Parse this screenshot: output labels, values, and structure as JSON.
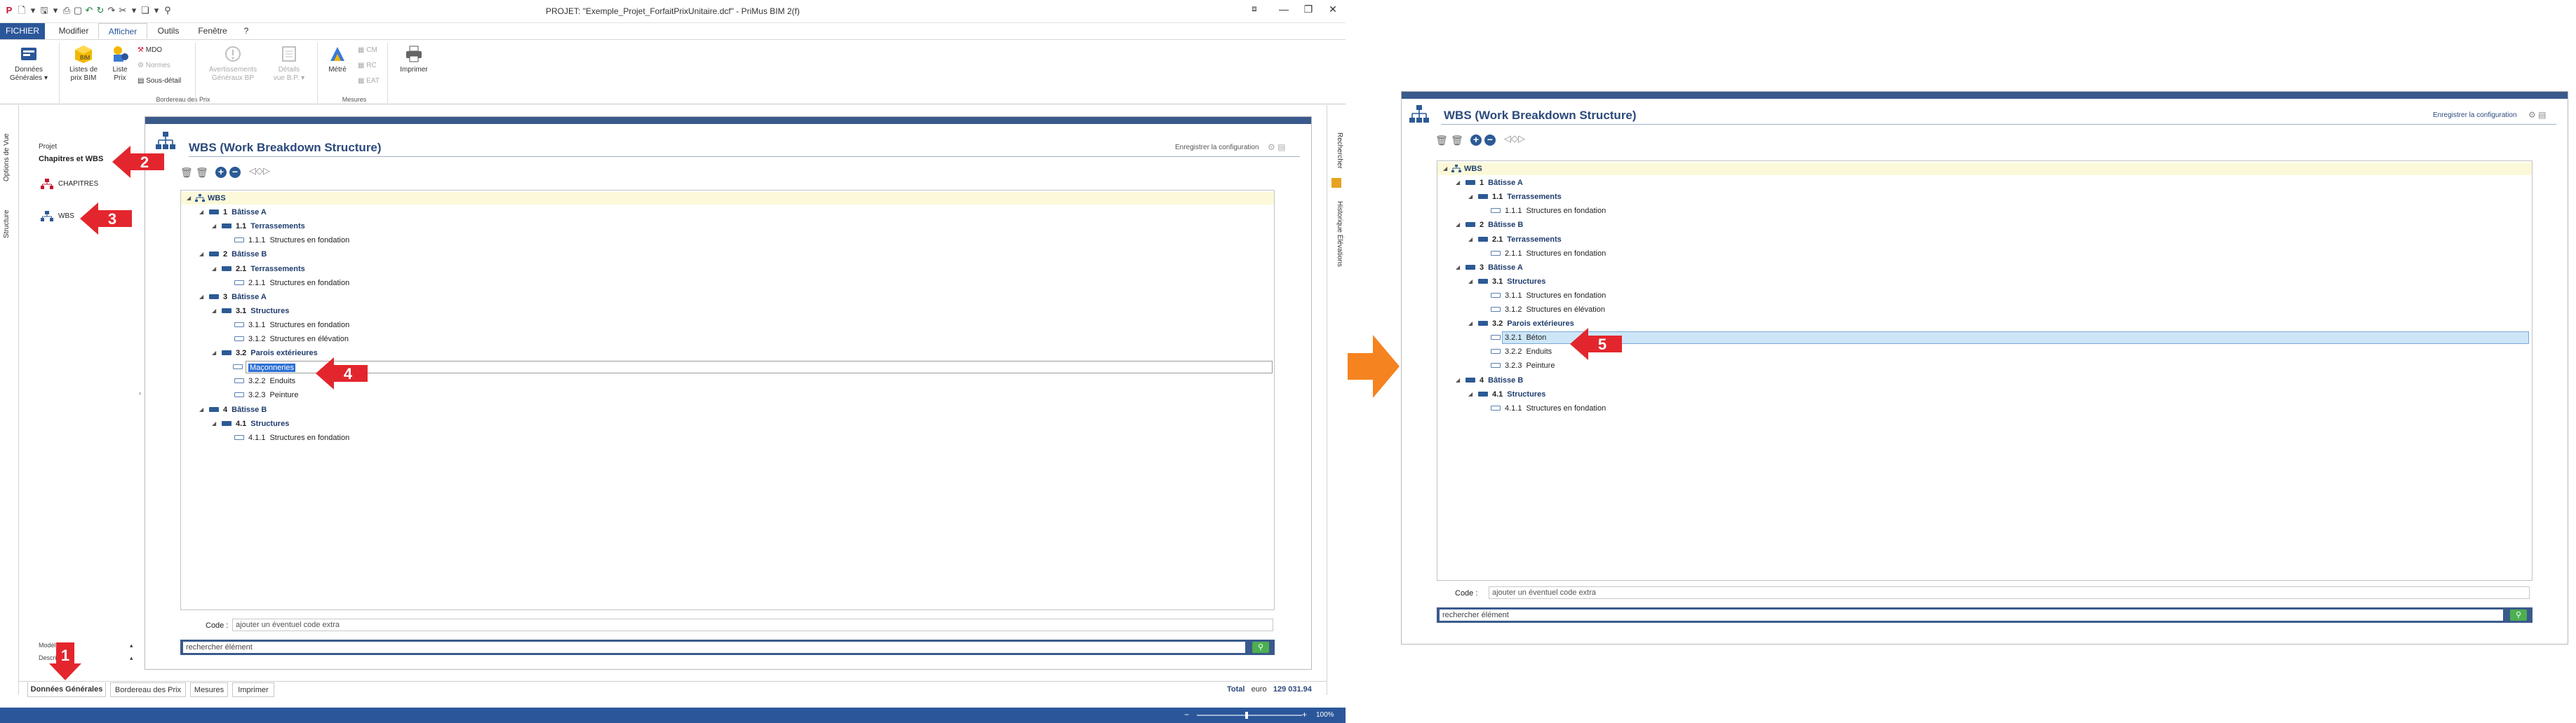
{
  "app": {
    "title": "PROJET: \"Exemple_Projet_ForfaitPrixUnitaire.dcf\" - PriMus  BIM 2(f)",
    "menu": [
      "FICHIER",
      "Modifier",
      "Afficher",
      "Outils",
      "Fenêtre",
      "?"
    ],
    "active_menu": "Afficher",
    "window_controls": [
      "—",
      "❐",
      "✕"
    ]
  },
  "ribbon": {
    "groups": [
      {
        "label": "",
        "buttons": [
          {
            "label": "Données\nGénérales ▾"
          }
        ]
      },
      {
        "label": "Bordereau des Prix",
        "buttons": [
          {
            "label": "Listes de\nprix BIM"
          },
          {
            "label": "Liste\nPrix"
          }
        ],
        "small": [
          "MDO",
          "Normes",
          "Sous-détail"
        ]
      },
      {
        "label": "",
        "buttons": [
          {
            "label": "Avertissements\nGénéraux BP",
            "disabled": true
          },
          {
            "label": "Détails\nvue B.P. ▾",
            "disabled": true
          }
        ]
      },
      {
        "label": "Mesures",
        "buttons": [
          {
            "label": "Métré"
          }
        ],
        "small": [
          "CM",
          "RC",
          "EAT"
        ]
      },
      {
        "label": "",
        "buttons": [
          {
            "label": "Imprimer"
          }
        ]
      }
    ]
  },
  "left_tabs": [
    "Options de Vue",
    "Structure"
  ],
  "right_tabs": [
    "Rechercher",
    "Historique Élévations"
  ],
  "nav": {
    "project_label": "Projet",
    "section_title": "Chapitres et WBS",
    "items": [
      "CHAPITRES",
      "WBS"
    ],
    "bottom_rows": [
      "Modèle…",
      "Description"
    ]
  },
  "bottom_tabs": [
    "Données Générales",
    "Bordereau des Prix",
    "Mesures",
    "Imprimer"
  ],
  "status": {
    "total_label": "Total",
    "currency": "euro",
    "total_value": "129 031.94",
    "zoom": "100%"
  },
  "wbs_left": {
    "title": "WBS (Work Breakdown Structure)",
    "save_config": "Enregistrer la configuration",
    "code_label": "Code :",
    "code_placeholder": "ajouter un éventuel code extra",
    "search_placeholder": "rechercher élément",
    "rows": [
      {
        "code": "",
        "label": "WBS",
        "level": 0,
        "kind": "root"
      },
      {
        "code": "1",
        "label": "Bâtisse A",
        "level": 1,
        "kind": "dark"
      },
      {
        "code": "1.1",
        "label": "Terrassements",
        "level": 2,
        "kind": "dark"
      },
      {
        "code": "1.1.1",
        "label": "Structures en fondation",
        "level": 3,
        "kind": "light"
      },
      {
        "code": "2",
        "label": "Bâtisse B",
        "level": 1,
        "kind": "dark"
      },
      {
        "code": "2.1",
        "label": "Terrassements",
        "level": 2,
        "kind": "dark"
      },
      {
        "code": "2.1.1",
        "label": "Structures en fondation",
        "level": 3,
        "kind": "light"
      },
      {
        "code": "3",
        "label": "Bâtisse A",
        "level": 1,
        "kind": "dark"
      },
      {
        "code": "3.1",
        "label": "Structures",
        "level": 2,
        "kind": "dark"
      },
      {
        "code": "3.1.1",
        "label": "Structures en fondation",
        "level": 3,
        "kind": "light"
      },
      {
        "code": "3.1.2",
        "label": "Structures en élévation",
        "level": 3,
        "kind": "light"
      },
      {
        "code": "3.2",
        "label": "Parois extérieures",
        "level": 2,
        "kind": "dark"
      },
      {
        "code": "",
        "label": "Maçonneries",
        "level": 3,
        "kind": "light",
        "editing": true
      },
      {
        "code": "3.2.2",
        "label": "Enduits",
        "level": 3,
        "kind": "light"
      },
      {
        "code": "3.2.3",
        "label": "Peinture",
        "level": 3,
        "kind": "light"
      },
      {
        "code": "4",
        "label": "Bâtisse B",
        "level": 1,
        "kind": "dark"
      },
      {
        "code": "4.1",
        "label": "Structures",
        "level": 2,
        "kind": "dark"
      },
      {
        "code": "4.1.1",
        "label": "Structures en fondation",
        "level": 3,
        "kind": "light"
      }
    ]
  },
  "wbs_right": {
    "title": "WBS (Work Breakdown Structure)",
    "save_config": "Enregistrer la configuration",
    "code_label": "Code :",
    "code_placeholder": "ajouter un éventuel code extra",
    "search_placeholder": "rechercher élément",
    "rows": [
      {
        "code": "",
        "label": "WBS",
        "level": 0,
        "kind": "root"
      },
      {
        "code": "1",
        "label": "Bâtisse A",
        "level": 1,
        "kind": "dark"
      },
      {
        "code": "1.1",
        "label": "Terrassements",
        "level": 2,
        "kind": "dark"
      },
      {
        "code": "1.1.1",
        "label": "Structures en fondation",
        "level": 3,
        "kind": "light"
      },
      {
        "code": "2",
        "label": "Bâtisse B",
        "level": 1,
        "kind": "dark"
      },
      {
        "code": "2.1",
        "label": "Terrassements",
        "level": 2,
        "kind": "dark"
      },
      {
        "code": "2.1.1",
        "label": "Structures en fondation",
        "level": 3,
        "kind": "light"
      },
      {
        "code": "3",
        "label": "Bâtisse A",
        "level": 1,
        "kind": "dark"
      },
      {
        "code": "3.1",
        "label": "Structures",
        "level": 2,
        "kind": "dark"
      },
      {
        "code": "3.1.1",
        "label": "Structures en fondation",
        "level": 3,
        "kind": "light"
      },
      {
        "code": "3.1.2",
        "label": "Structures en élévation",
        "level": 3,
        "kind": "light"
      },
      {
        "code": "3.2",
        "label": "Parois extérieures",
        "level": 2,
        "kind": "dark"
      },
      {
        "code": "3.2.1",
        "label": "Béton",
        "level": 3,
        "kind": "light",
        "selected": true
      },
      {
        "code": "3.2.2",
        "label": "Enduits",
        "level": 3,
        "kind": "light"
      },
      {
        "code": "3.2.3",
        "label": "Peinture",
        "level": 3,
        "kind": "light"
      },
      {
        "code": "4",
        "label": "Bâtisse B",
        "level": 1,
        "kind": "dark"
      },
      {
        "code": "4.1",
        "label": "Structures",
        "level": 2,
        "kind": "dark"
      },
      {
        "code": "4.1.1",
        "label": "Structures en fondation",
        "level": 3,
        "kind": "light"
      }
    ]
  },
  "callouts": [
    "1",
    "2",
    "3",
    "4",
    "5"
  ],
  "colors": {
    "accent": "#2b579a",
    "callout": "#e3262d",
    "transition_arrow": "#f5831f",
    "selection": "#cde6f7",
    "root_row": "#fbf9d9"
  }
}
